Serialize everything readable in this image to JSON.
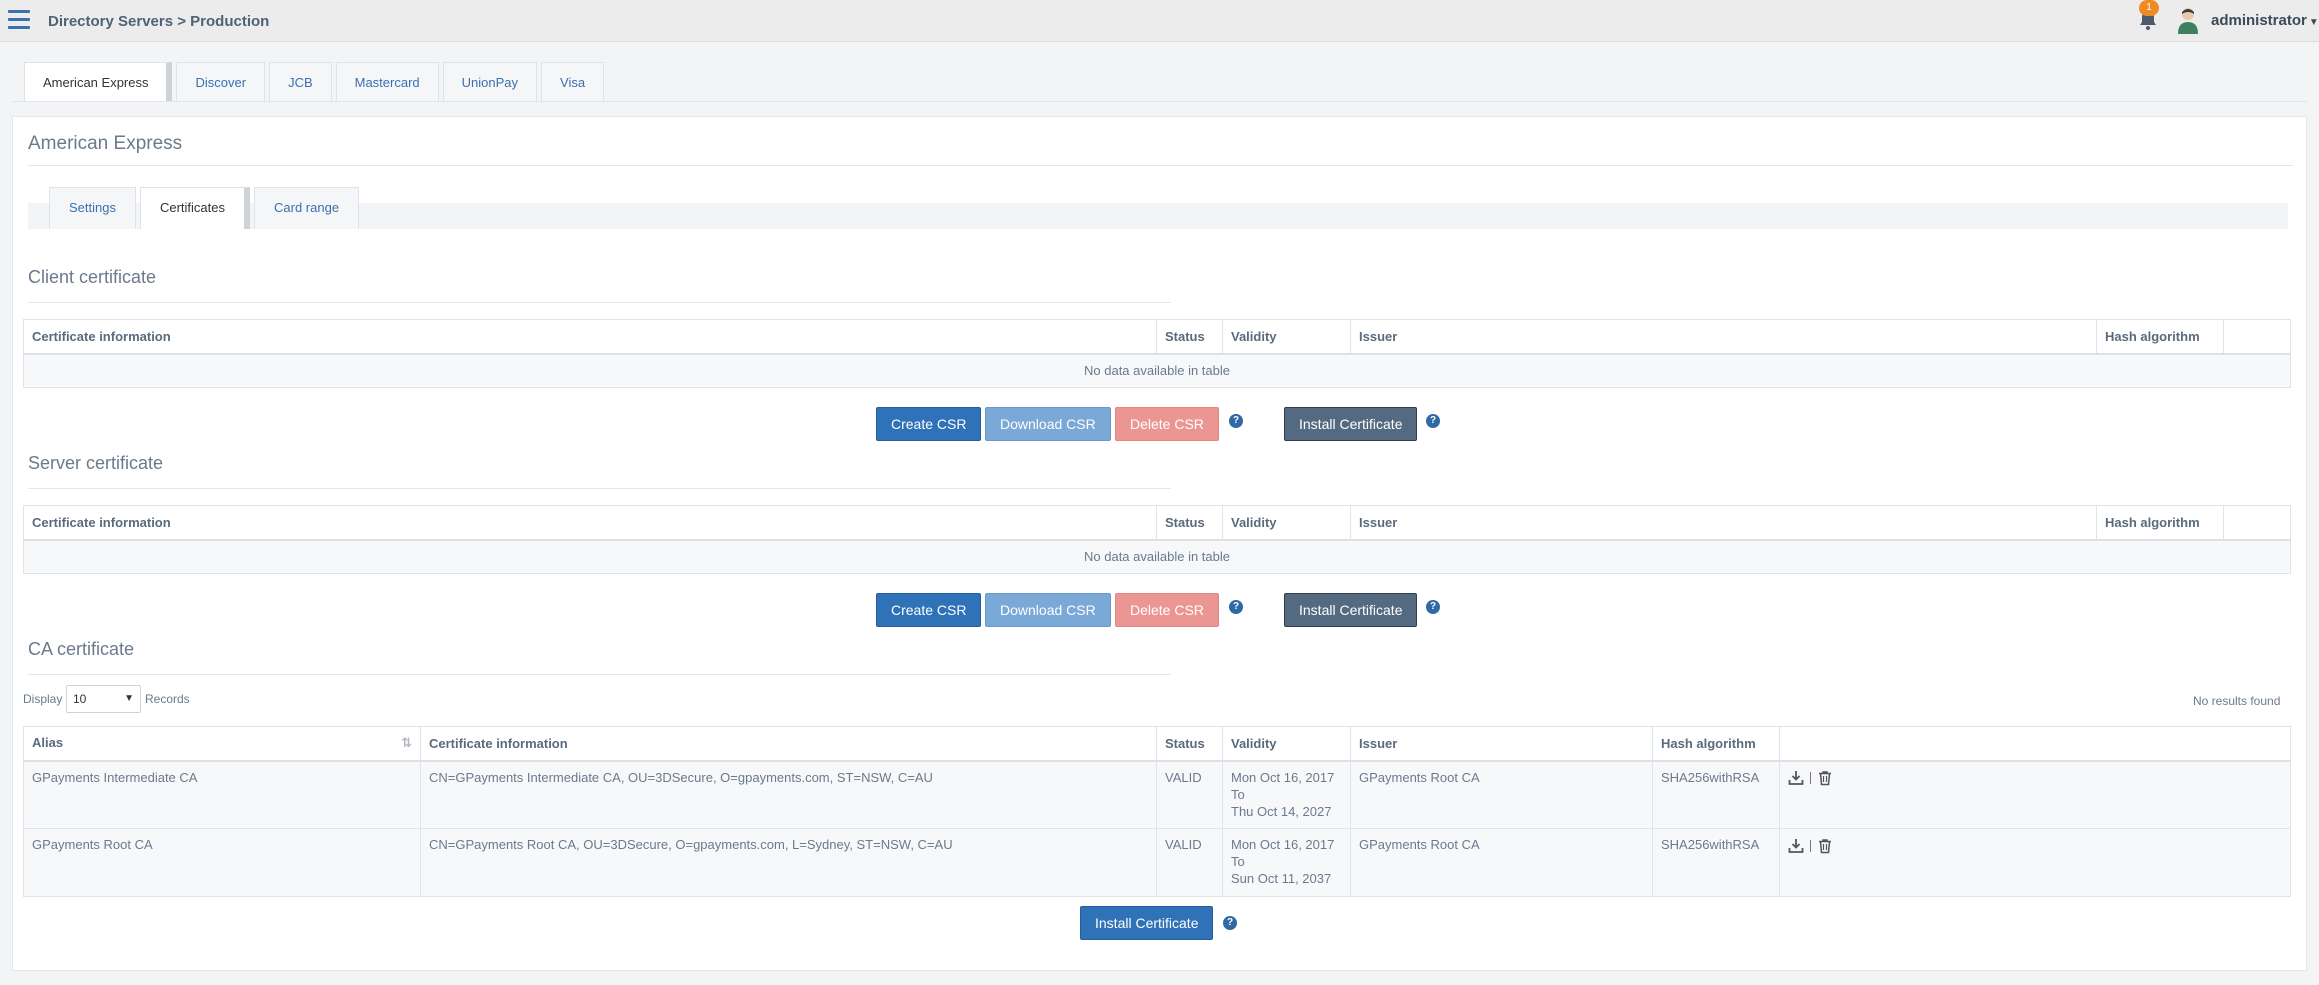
{
  "header": {
    "breadcrumb": "Directory Servers > Production",
    "notification_count": "1",
    "username": "administrator"
  },
  "scheme_tabs": [
    {
      "label": "American Express",
      "active": true
    },
    {
      "label": "Discover"
    },
    {
      "label": "JCB"
    },
    {
      "label": "Mastercard"
    },
    {
      "label": "UnionPay"
    },
    {
      "label": "Visa"
    }
  ],
  "panel": {
    "title": "American Express",
    "tabs": [
      {
        "label": "Settings"
      },
      {
        "label": "Certificates",
        "active": true
      },
      {
        "label": "Card range"
      }
    ]
  },
  "client_certificate": {
    "title": "Client certificate",
    "columns": [
      "Certificate information",
      "Status",
      "Validity",
      "Issuer",
      "Hash algorithm",
      ""
    ],
    "empty_text": "No data available in table",
    "buttons": {
      "create": "Create CSR",
      "download": "Download CSR",
      "delete": "Delete CSR",
      "install": "Install Certificate"
    }
  },
  "server_certificate": {
    "title": "Server certificate",
    "columns": [
      "Certificate information",
      "Status",
      "Validity",
      "Issuer",
      "Hash algorithm",
      ""
    ],
    "empty_text": "No data available in table",
    "buttons": {
      "create": "Create CSR",
      "download": "Download CSR",
      "delete": "Delete CSR",
      "install": "Install Certificate"
    }
  },
  "ca_certificate": {
    "title": "CA certificate",
    "display_label": "Display",
    "page_size": "10",
    "records_label": "Records",
    "no_results": "No results found",
    "columns": [
      "Alias",
      "Certificate information",
      "Status",
      "Validity",
      "Issuer",
      "Hash algorithm",
      ""
    ],
    "rows": [
      {
        "alias": "GPayments Intermediate CA",
        "info": "CN=GPayments Intermediate CA, OU=3DSecure, O=gpayments.com, ST=NSW, C=AU",
        "status": "VALID",
        "valid_from": "Mon Oct 16, 2017",
        "to": "To",
        "valid_to": "Thu Oct 14, 2027",
        "issuer": "GPayments Root CA",
        "hash": "SHA256withRSA"
      },
      {
        "alias": "GPayments Root CA",
        "info": "CN=GPayments Root CA, OU=3DSecure, O=gpayments.com, L=Sydney, ST=NSW, C=AU",
        "status": "VALID",
        "valid_from": "Mon Oct 16, 2017",
        "to": "To",
        "valid_to": "Sun Oct 11, 2037",
        "issuer": "GPayments Root CA",
        "hash": "SHA256withRSA"
      }
    ],
    "install_button": "Install Certificate"
  },
  "icons": {
    "menu": "hamburger-icon",
    "notifications": "bell-icon",
    "avatar": "user-avatar-icon",
    "help": "question-circle-icon",
    "download": "download-icon",
    "delete": "trash-icon",
    "sort": "sort-icon"
  }
}
